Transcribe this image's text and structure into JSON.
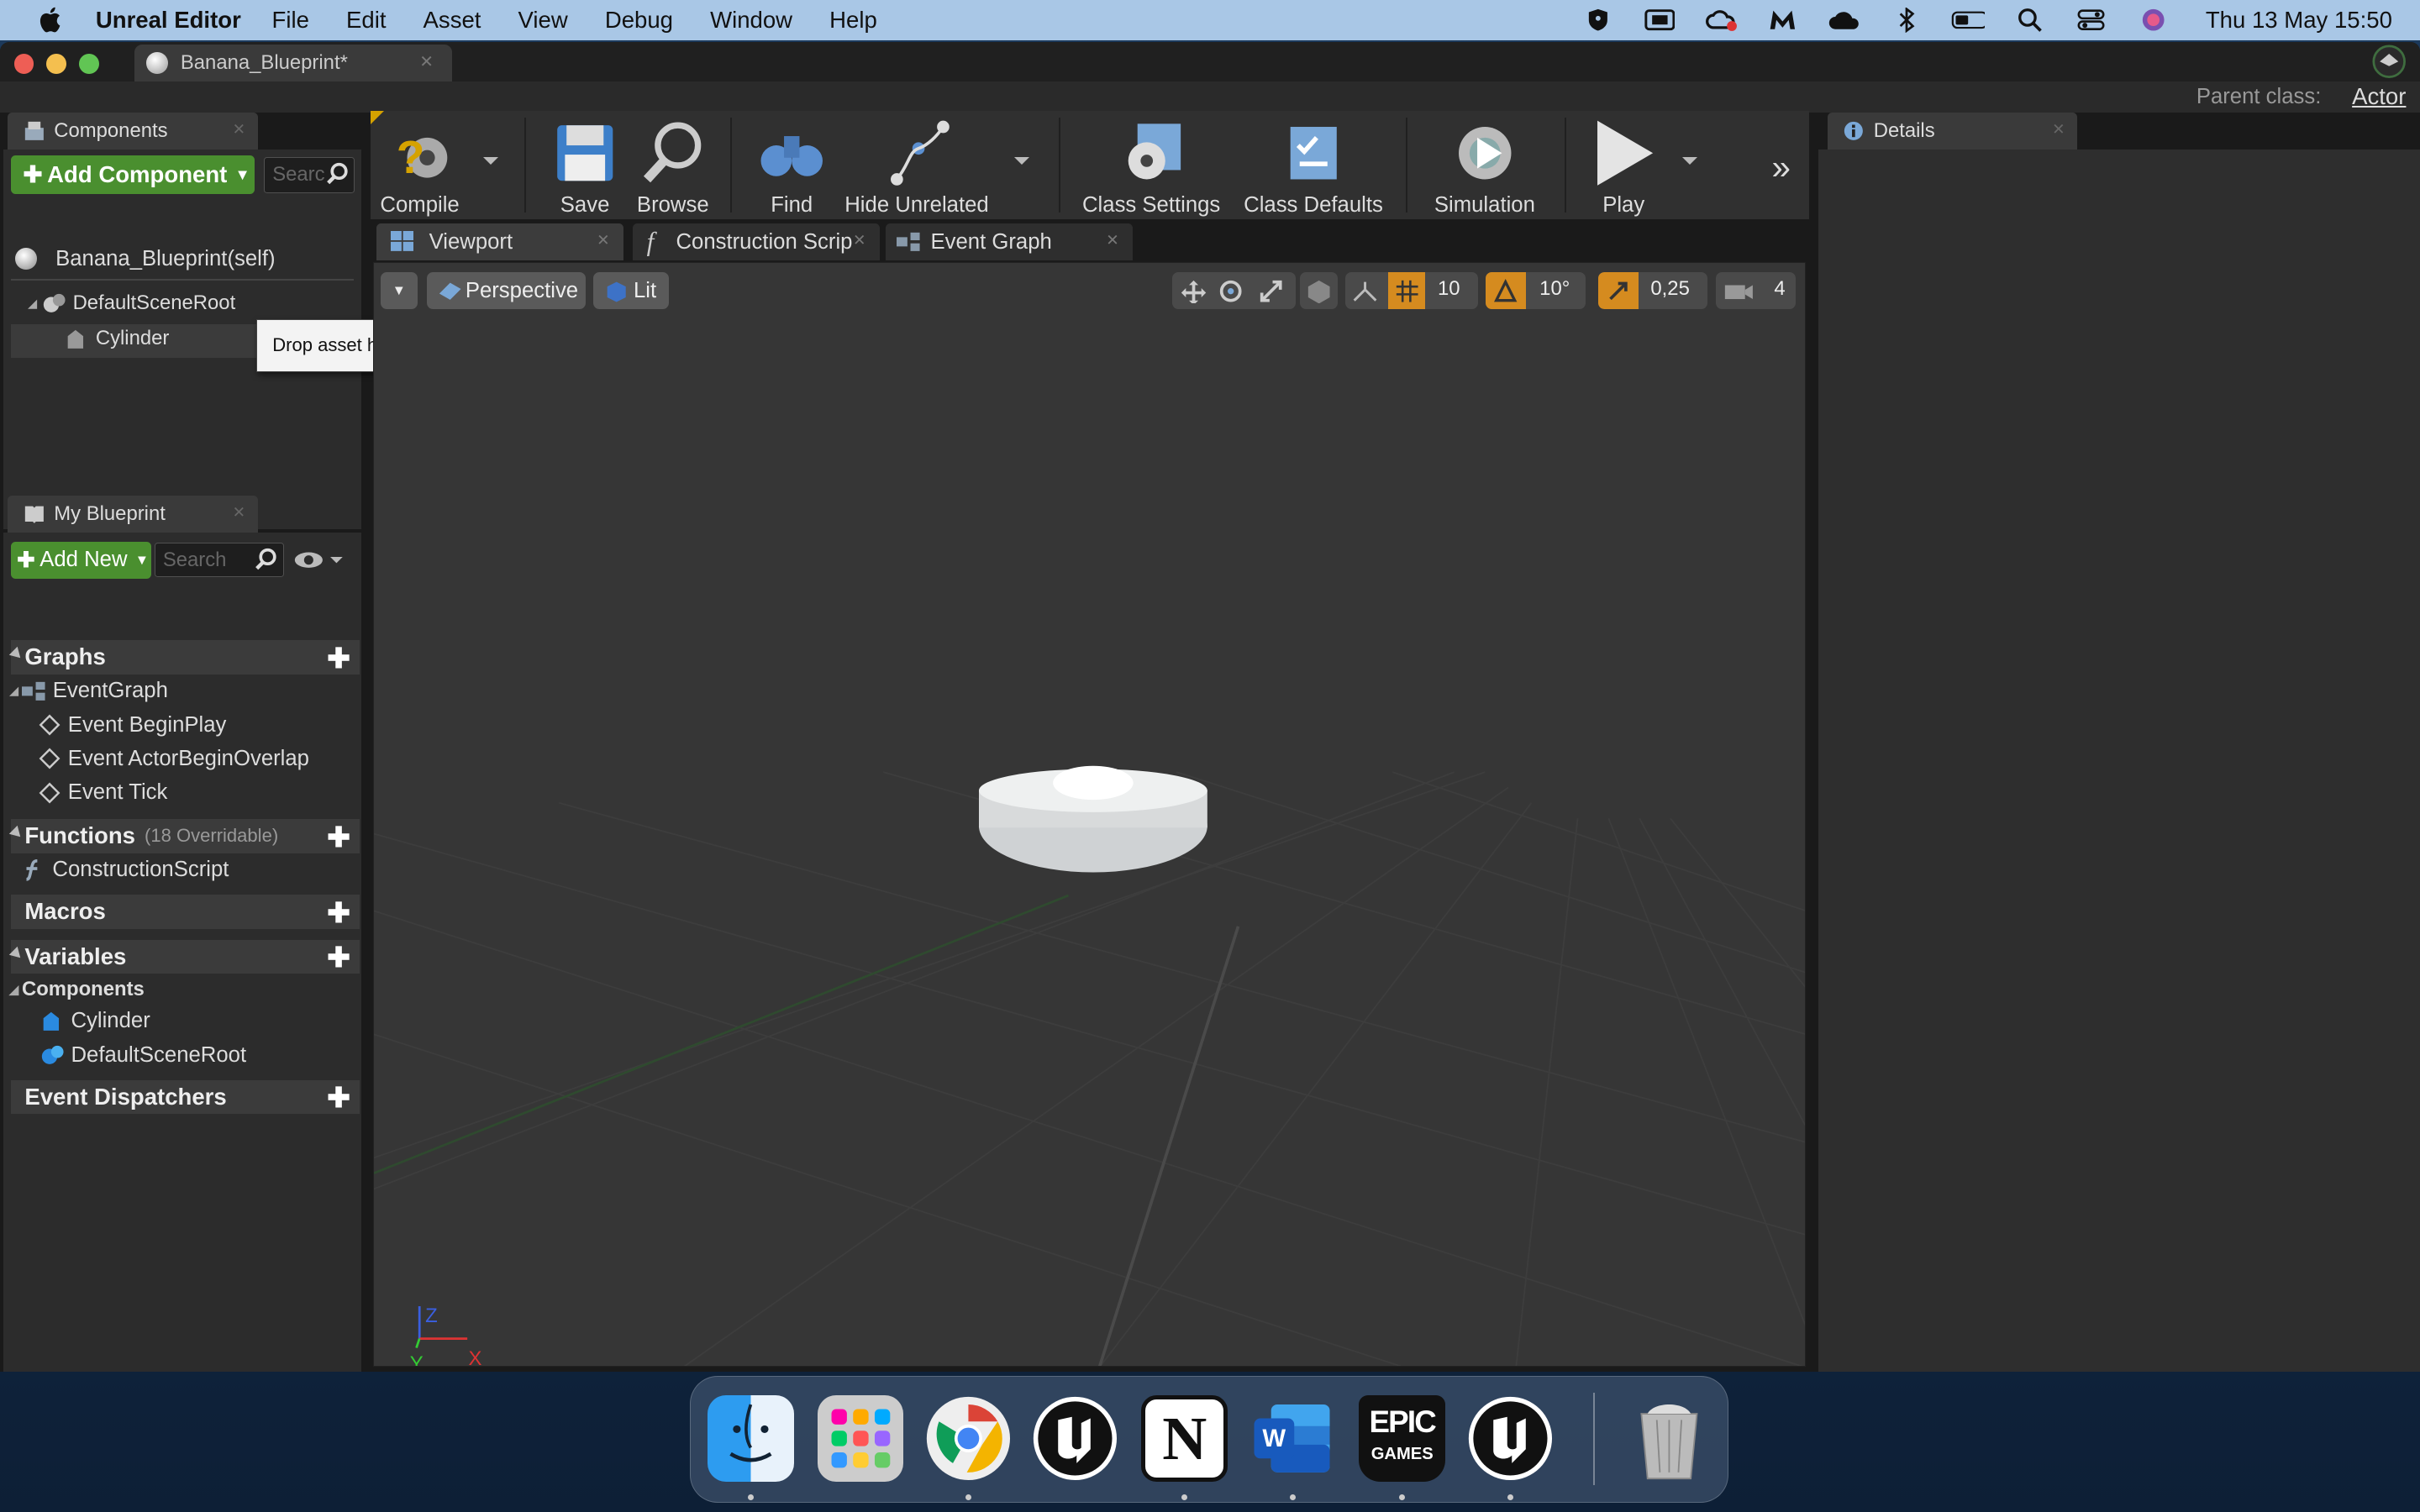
{
  "menubar": {
    "app_name": "Unreal Editor",
    "items": [
      "File",
      "Edit",
      "Asset",
      "View",
      "Debug",
      "Window",
      "Help"
    ],
    "clock": "Thu 13 May  15:50"
  },
  "window": {
    "tab_title": "Banana_Blueprint*",
    "parent_class_label": "Parent class:",
    "parent_class_value": "Actor"
  },
  "components_panel": {
    "tab": "Components",
    "add_button": "Add Component",
    "search_placeholder": "Search",
    "self_item": "Banana_Blueprint(self)",
    "tree": [
      "DefaultSceneRoot",
      "Cylinder"
    ],
    "tooltip": "Drop asset here to add a component."
  },
  "my_blueprint": {
    "tab": "My Blueprint",
    "add_button": "Add New",
    "search_placeholder": "Search",
    "graphs_header": "Graphs",
    "eventgraph": "EventGraph",
    "events": [
      "Event BeginPlay",
      "Event ActorBeginOverlap",
      "Event Tick"
    ],
    "functions_header": "Functions",
    "functions_sub": "(18 Overridable)",
    "construction_script": "ConstructionScript",
    "macros_header": "Macros",
    "variables_header": "Variables",
    "components_header": "Components",
    "component_vars": [
      "Cylinder",
      "DefaultSceneRoot"
    ],
    "dispatchers_header": "Event Dispatchers"
  },
  "toolbar": {
    "compile": "Compile",
    "save": "Save",
    "browse": "Browse",
    "find": "Find",
    "hide_unrelated": "Hide Unrelated",
    "class_settings": "Class Settings",
    "class_defaults": "Class Defaults",
    "simulation": "Simulation",
    "play": "Play"
  },
  "doc_tabs": {
    "viewport": "Viewport",
    "construction": "Construction Scrip",
    "event_graph": "Event Graph"
  },
  "viewport": {
    "perspective": "Perspective",
    "lit": "Lit",
    "grid_snap": "10",
    "rotation_snap": "10°",
    "scale_snap": "0,25",
    "camera_speed": "4",
    "axis_x": "X",
    "axis_y": "Y",
    "axis_z": "Z"
  },
  "details": {
    "tab": "Details"
  },
  "colors": {
    "accent_green": "#4a8f2f",
    "snap_orange": "#d58b1f",
    "menubar": "#a9c7e6"
  },
  "dock": {
    "apps": [
      "finder-icon",
      "launchpad-icon",
      "chrome-icon",
      "unreal-icon",
      "notion-icon",
      "word-icon",
      "epic-games-icon",
      "unreal-icon",
      "trash-icon"
    ],
    "epic_label_1": "EPIC",
    "epic_label_2": "GAMES",
    "notion_letter": "N",
    "word_letter": "W"
  }
}
